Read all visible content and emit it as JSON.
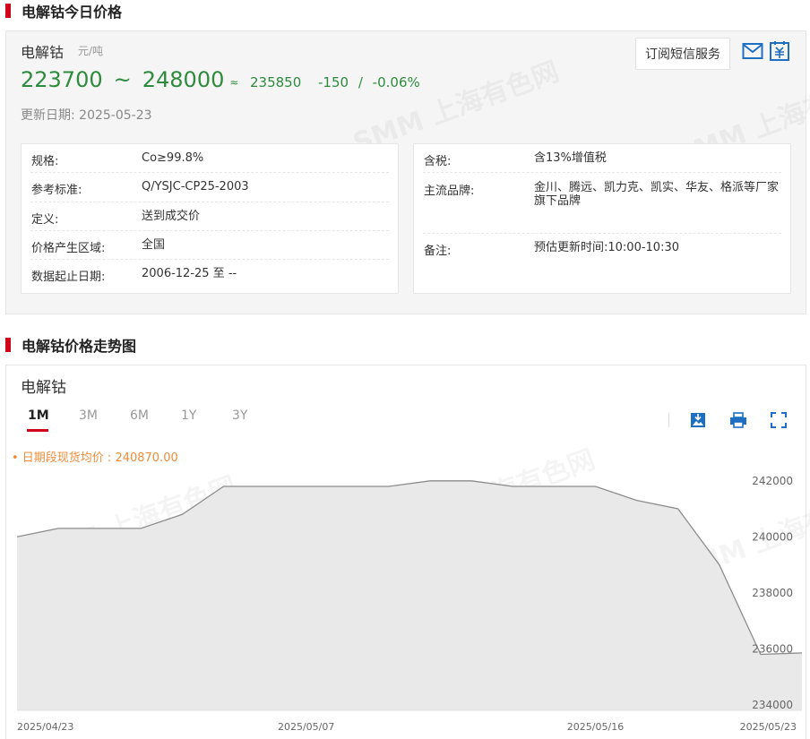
{
  "section1": {
    "title": "电解钴今日价格"
  },
  "product": {
    "name": "电解钴",
    "unit": "元/吨",
    "price_low": "223700",
    "tilde": "~",
    "price_high": "248000",
    "trend_icon": "≈",
    "average": "235850",
    "change": "-150",
    "change_sep": "/",
    "change_pct": "-0.06%",
    "update_label": "更新日期:",
    "update_date": "2025-05-23",
    "subscribe_label": "订阅短信服务",
    "icons": [
      "mail-icon",
      "calendar-icon"
    ]
  },
  "info_left": [
    {
      "k": "规格:",
      "v": "Co≥99.8%"
    },
    {
      "k": "参考标准:",
      "v": "Q/YSJC-CP25-2003"
    },
    {
      "k": "定义:",
      "v": "送到成交价"
    },
    {
      "k": "价格产生区域:",
      "v": "全国"
    },
    {
      "k": "数据起止日期:",
      "v": "2006-12-25 至 --"
    }
  ],
  "info_right": [
    {
      "k": "含税:",
      "v": "含13%增值税"
    },
    {
      "k": "主流品牌:",
      "v": "金川、腾远、凯力克、凯实、华友、格派等厂家旗下品牌"
    },
    {
      "k": "备注:",
      "v": "预估更新时间:10:00-10:30"
    }
  ],
  "section2": {
    "title": "电解钴价格走势图"
  },
  "chart": {
    "name": "电解钴",
    "tabs": [
      "1M",
      "3M",
      "6M",
      "1Y",
      "3Y"
    ],
    "active_tab": "1M",
    "tool_icons": [
      "download-image-icon",
      "print-icon",
      "fullscreen-icon"
    ],
    "avg_label": "• 日期段现货均价 : 240870.00",
    "watermark": "SMM 上海有色网"
  },
  "chart_data": {
    "type": "area",
    "x": [
      "2025/04/23",
      "2025/04/24",
      "2025/04/25",
      "2025/04/28",
      "2025/04/29",
      "2025/04/30",
      "2025/05/06",
      "2025/05/07",
      "2025/05/08",
      "2025/05/09",
      "2025/05/12",
      "2025/05/13",
      "2025/05/14",
      "2025/05/15",
      "2025/05/16",
      "2025/05/19",
      "2025/05/20",
      "2025/05/21",
      "2025/05/22",
      "2025/05/23"
    ],
    "values": [
      240000,
      240300,
      240300,
      240300,
      240800,
      241800,
      241800,
      241800,
      241800,
      241800,
      242000,
      242000,
      241800,
      241800,
      241800,
      241300,
      241000,
      239000,
      235800,
      235850
    ],
    "xtick_labels": [
      "2025/04/23",
      "2025/05/07",
      "2025/05/16",
      "2025/05/23"
    ],
    "yticks": [
      234000,
      236000,
      238000,
      240000,
      242000
    ],
    "ylim": [
      233800,
      242600
    ],
    "colors": {
      "line": "#8c8c8c",
      "fill": "#e9e9e9",
      "axis_text": "#666666",
      "avg_label": "#f08c3a"
    }
  }
}
